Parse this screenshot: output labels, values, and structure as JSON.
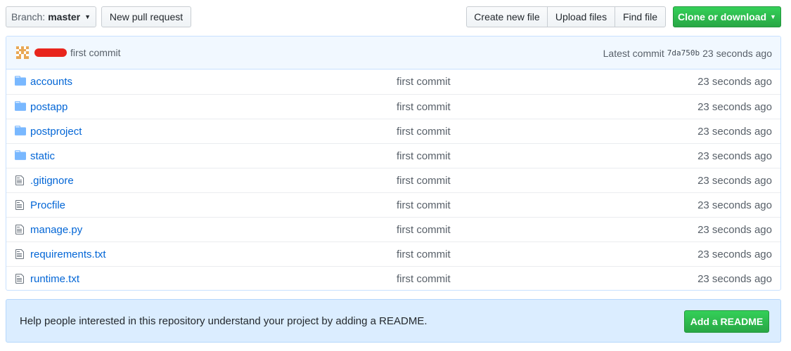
{
  "toolbar": {
    "branch_prefix": "Branch:",
    "branch_name": "master",
    "new_pr_label": "New pull request",
    "create_file_label": "Create new file",
    "upload_files_label": "Upload files",
    "find_file_label": "Find file",
    "clone_label": "Clone or download"
  },
  "commit_bar": {
    "message": "first commit",
    "latest_label": "Latest commit",
    "sha": "7da750b",
    "time": "23 seconds ago"
  },
  "files": [
    {
      "name": "accounts",
      "type": "folder",
      "message": "first commit",
      "age": "23 seconds ago"
    },
    {
      "name": "postapp",
      "type": "folder",
      "message": "first commit",
      "age": "23 seconds ago"
    },
    {
      "name": "postproject",
      "type": "folder",
      "message": "first commit",
      "age": "23 seconds ago"
    },
    {
      "name": "static",
      "type": "folder",
      "message": "first commit",
      "age": "23 seconds ago"
    },
    {
      "name": ".gitignore",
      "type": "file",
      "message": "first commit",
      "age": "23 seconds ago"
    },
    {
      "name": "Procfile",
      "type": "file",
      "message": "first commit",
      "age": "23 seconds ago"
    },
    {
      "name": "manage.py",
      "type": "file",
      "message": "first commit",
      "age": "23 seconds ago"
    },
    {
      "name": "requirements.txt",
      "type": "file",
      "message": "first commit",
      "age": "23 seconds ago"
    },
    {
      "name": "runtime.txt",
      "type": "file",
      "message": "first commit",
      "age": "23 seconds ago"
    }
  ],
  "readme_banner": {
    "text": "Help people interested in this repository understand your project by adding a README.",
    "button_label": "Add a README"
  },
  "colors": {
    "link": "#0366d6",
    "muted": "#586069",
    "green": "#28a745",
    "folder": "#79b8ff",
    "commit_bg": "#f1f8ff",
    "banner_bg": "#dbedff"
  },
  "icons": {
    "folder": "folder-icon",
    "file": "file-icon"
  }
}
